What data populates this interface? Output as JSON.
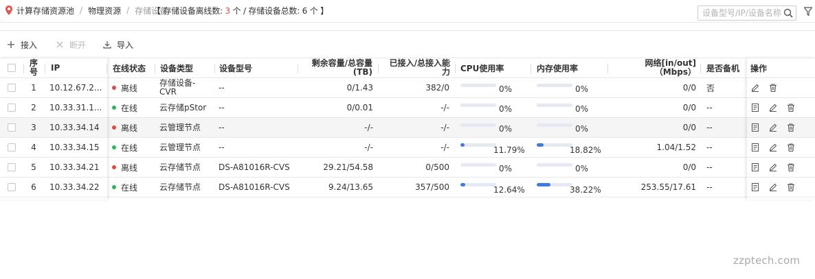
{
  "breadcrumb": {
    "items": [
      "计算存储资源池",
      "物理资源",
      "存储设备"
    ],
    "sep": "/"
  },
  "summary": {
    "prefix": "【 存储设备离线数: ",
    "offline_count": "3",
    "middle": " 个 / 存储设备总数: 6 个 】"
  },
  "search": {
    "placeholder": "设备型号/IP/设备名称"
  },
  "toolbar": {
    "connect_label": "接入",
    "disconnect_label": "断开",
    "import_label": "导入"
  },
  "table": {
    "headers": {
      "seq": "序号",
      "ip": "IP",
      "status": "在线状态",
      "type": "设备类型",
      "model": "设备型号",
      "capacity": "剩余容量/总容量(TB)",
      "access": "已接入/总接入能力",
      "cpu": "CPU使用率",
      "mem": "内存使用率",
      "net": "网络[in/out]（Mbps）",
      "backup": "是否备机",
      "ops": "操作"
    },
    "rows": [
      {
        "seq": "1",
        "ip": "10.12.67.2...",
        "status": "离线",
        "online": false,
        "type": "存储设备-CVR",
        "model": "--",
        "capacity": "0/1.43",
        "access": "382/0",
        "cpu": "0%",
        "cpu_val": 0,
        "mem": "0%",
        "mem_val": 0,
        "net": "0/0",
        "backup": "否",
        "has_detail": false,
        "highlight": false
      },
      {
        "seq": "2",
        "ip": "10.33.31.1...",
        "status": "在线",
        "online": true,
        "type": "云存储pStor",
        "model": "--",
        "capacity": "0/0.01",
        "access": "-/-",
        "cpu": "0%",
        "cpu_val": 0,
        "mem": "0%",
        "mem_val": 0,
        "net": "0/0",
        "backup": "--",
        "has_detail": true,
        "highlight": false
      },
      {
        "seq": "3",
        "ip": "10.33.34.14",
        "status": "离线",
        "online": false,
        "type": "云管理节点",
        "model": "--",
        "capacity": "-/-",
        "access": "-/-",
        "cpu": "0%",
        "cpu_val": 0,
        "mem": "0%",
        "mem_val": 0,
        "net": "0/0",
        "backup": "--",
        "has_detail": true,
        "highlight": true
      },
      {
        "seq": "4",
        "ip": "10.33.34.15",
        "status": "在线",
        "online": true,
        "type": "云管理节点",
        "model": "--",
        "capacity": "-/-",
        "access": "-/-",
        "cpu": "11.79%",
        "cpu_val": 11.79,
        "mem": "18.82%",
        "mem_val": 18.82,
        "net": "1.04/1.52",
        "backup": "--",
        "has_detail": true,
        "highlight": false
      },
      {
        "seq": "5",
        "ip": "10.33.34.21",
        "status": "离线",
        "online": false,
        "type": "云存储节点",
        "model": "DS-A81016R-CVS",
        "capacity": "29.21/54.58",
        "access": "0/500",
        "cpu": "0%",
        "cpu_val": 0,
        "mem": "0%",
        "mem_val": 0,
        "net": "0/0",
        "backup": "--",
        "has_detail": true,
        "highlight": false
      },
      {
        "seq": "6",
        "ip": "10.33.34.22",
        "status": "在线",
        "online": true,
        "type": "云存储节点",
        "model": "DS-A81016R-CVS",
        "capacity": "9.24/13.65",
        "access": "357/500",
        "cpu": "12.64%",
        "cpu_val": 12.64,
        "mem": "38.22%",
        "mem_val": 38.22,
        "net": "253.55/17.61",
        "backup": "--",
        "has_detail": true,
        "highlight": false
      }
    ]
  },
  "colors": {
    "online": "#2db55d",
    "offline": "#e84545",
    "bar_fill": "#3a7bdd",
    "bar_track": "#e6e9f2",
    "pin": "#e8534a"
  },
  "watermark": "zzptech.com"
}
